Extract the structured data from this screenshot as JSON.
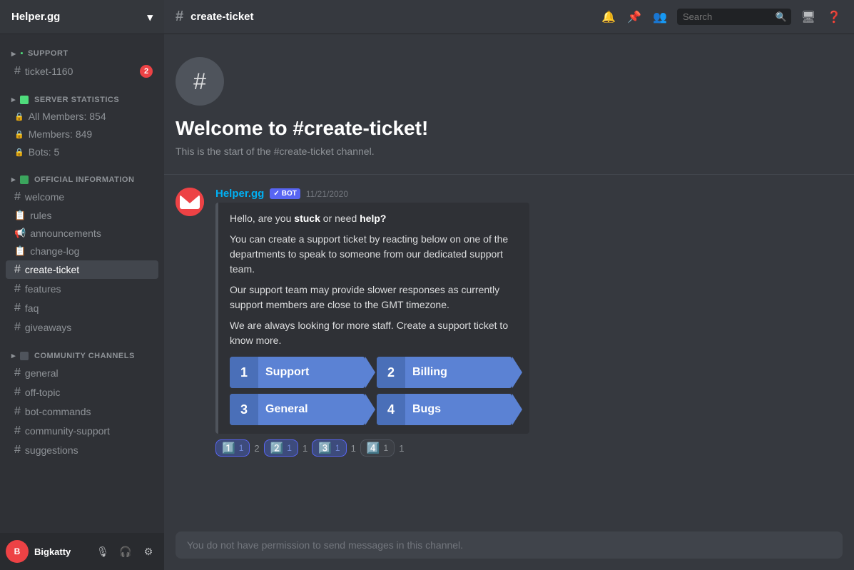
{
  "server": {
    "name": "Helper.gg",
    "chevron": "▾"
  },
  "sidebar": {
    "sections": [
      {
        "id": "support",
        "icon": "📋",
        "label": "SUPPORT",
        "channels": [
          {
            "id": "ticket-1160",
            "name": "ticket-1160",
            "prefix": "#",
            "badge": "2",
            "type": "text"
          }
        ]
      },
      {
        "id": "server-statistics",
        "icon": "📊",
        "label": "SERVER STATISTICS",
        "channels": [
          {
            "id": "all-members",
            "name": "All Members: 854",
            "prefix": "🔒",
            "type": "locked"
          },
          {
            "id": "members",
            "name": "Members: 849",
            "prefix": "🔒",
            "type": "locked"
          },
          {
            "id": "bots",
            "name": "Bots: 5",
            "prefix": "🔒",
            "type": "locked"
          }
        ]
      },
      {
        "id": "official-information",
        "icon": "✅",
        "label": "OFFICIAL INFORMATION",
        "channels": [
          {
            "id": "welcome",
            "name": "welcome",
            "prefix": "#",
            "type": "text"
          },
          {
            "id": "rules",
            "name": "rules",
            "prefix": "📋",
            "type": "text"
          },
          {
            "id": "announcements",
            "name": "announcements",
            "prefix": "📢",
            "type": "text"
          },
          {
            "id": "change-log",
            "name": "change-log",
            "prefix": "📋",
            "type": "text"
          },
          {
            "id": "create-ticket",
            "name": "create-ticket",
            "prefix": "#",
            "type": "text",
            "active": true
          },
          {
            "id": "features",
            "name": "features",
            "prefix": "#",
            "type": "text"
          },
          {
            "id": "faq",
            "name": "faq",
            "prefix": "#",
            "type": "text"
          },
          {
            "id": "giveaways",
            "name": "giveaways",
            "prefix": "#",
            "type": "text"
          }
        ]
      },
      {
        "id": "community-channels",
        "icon": "💬",
        "label": "COMMUNITY CHANNELS",
        "channels": [
          {
            "id": "general",
            "name": "general",
            "prefix": "#",
            "type": "text"
          },
          {
            "id": "off-topic",
            "name": "off-topic",
            "prefix": "#",
            "type": "text"
          },
          {
            "id": "bot-commands",
            "name": "bot-commands",
            "prefix": "#",
            "type": "text"
          },
          {
            "id": "community-support",
            "name": "community-support",
            "prefix": "#",
            "type": "text"
          },
          {
            "id": "suggestions",
            "name": "suggestions",
            "prefix": "#",
            "type": "text"
          }
        ]
      }
    ],
    "user": {
      "name": "Bigkatty",
      "avatar_initials": "B",
      "avatar_color": "#ed4245"
    }
  },
  "topbar": {
    "channel_name": "create-ticket",
    "search_placeholder": "Search"
  },
  "main": {
    "welcome": {
      "icon": "#",
      "title": "Welcome to #create-ticket!",
      "subtitle": "This is the start of the #create-ticket channel."
    },
    "message": {
      "author": "Helper.gg",
      "bot_label": "BOT",
      "timestamp": "11/21/2020",
      "avatar_color": "#ed4245",
      "avatar_initials": "H",
      "embed": {
        "text_line1_pre": "Hello, are you ",
        "text_line1_bold1": "stuck",
        "text_line1_mid": " or need ",
        "text_line1_bold2": "help?",
        "text_line2": "You can create a support ticket by reacting below on one of the departments to speak to someone from our dedicated support team.",
        "text_line3": "Our support team may provide slower responses as currently support members are close to the GMT timezone.",
        "text_line4": "We are always looking for more staff. Create a support ticket to know more.",
        "buttons": [
          {
            "num": "1",
            "label": "Support"
          },
          {
            "num": "2",
            "label": "Billing"
          },
          {
            "num": "3",
            "label": "General"
          },
          {
            "num": "4",
            "label": "Bugs"
          }
        ]
      },
      "reactions": [
        {
          "emoji": "1️⃣",
          "count": "1",
          "active": true
        },
        {
          "emoji": "2️⃣",
          "count": "1",
          "active": true
        },
        {
          "emoji": "3️⃣",
          "count": "1",
          "active": true
        },
        {
          "emoji": "4️⃣",
          "count": "1",
          "active": false
        }
      ]
    },
    "input_placeholder": "You do not have permission to send messages in this channel."
  }
}
